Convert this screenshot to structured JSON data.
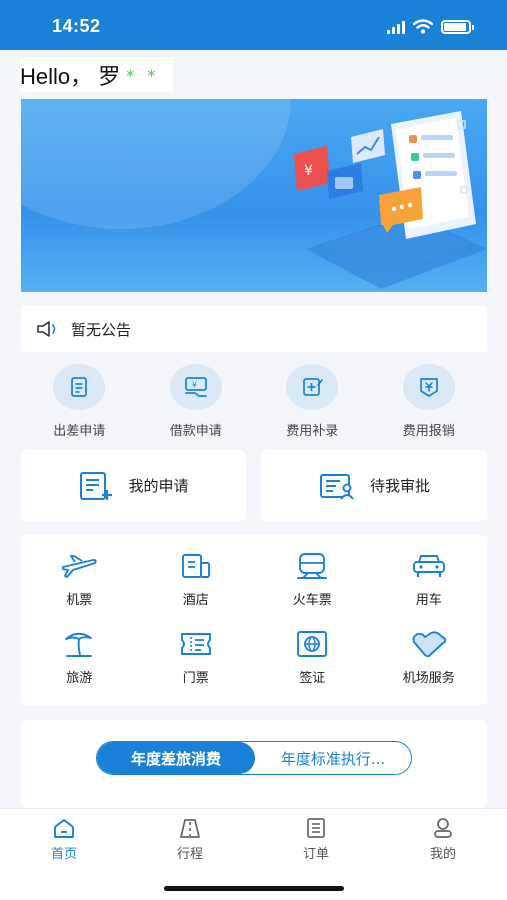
{
  "status_bar": {
    "time": "14:52"
  },
  "greeting": {
    "text": "Hello， 罗",
    "masked": "* *"
  },
  "announcement": {
    "text": "暂无公告"
  },
  "quick_actions": [
    {
      "label": "出差申请",
      "icon": "travel-request-icon"
    },
    {
      "label": "借款申请",
      "icon": "loan-request-icon"
    },
    {
      "label": "费用补录",
      "icon": "expense-supplement-icon"
    },
    {
      "label": "费用报销",
      "icon": "reimbursement-icon"
    }
  ],
  "applications": {
    "mine": "我的申请",
    "pending": "待我审批"
  },
  "services": [
    {
      "label": "机票",
      "icon": "airplane-icon"
    },
    {
      "label": "酒店",
      "icon": "hotel-icon"
    },
    {
      "label": "火车票",
      "icon": "train-icon"
    },
    {
      "label": "用车",
      "icon": "car-icon"
    },
    {
      "label": "旅游",
      "icon": "palm-tree-icon"
    },
    {
      "label": "门票",
      "icon": "ticket-icon"
    },
    {
      "label": "签证",
      "icon": "visa-icon"
    },
    {
      "label": "机场服务",
      "icon": "airport-service-icon"
    }
  ],
  "stats_tabs": {
    "active": "年度差旅消费",
    "inactive": "年度标准执行..."
  },
  "tabbar": [
    {
      "label": "首页",
      "icon": "home-icon",
      "active": true
    },
    {
      "label": "行程",
      "icon": "itinerary-icon",
      "active": false
    },
    {
      "label": "订单",
      "icon": "order-icon",
      "active": false
    },
    {
      "label": "我的",
      "icon": "profile-icon",
      "active": false
    }
  ],
  "colors": {
    "primary": "#1a82d6",
    "background": "#f3f6fb",
    "icon_circle": "#dbe8f6"
  }
}
